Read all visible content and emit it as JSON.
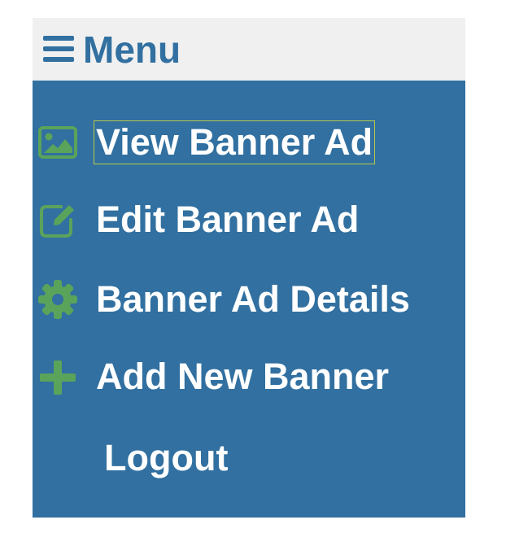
{
  "menu": {
    "title": "Menu",
    "icon": "hamburger-icon",
    "colors": {
      "header_bg": "#f0f0f0",
      "body_bg": "#3170a0",
      "accent": "#3170a0",
      "icon_green": "#5aa35a",
      "item_text": "#ffffff",
      "focus_outline": "#b8c84a"
    },
    "items": [
      {
        "label": "View Banner Ad",
        "icon": "image-icon",
        "focused": true
      },
      {
        "label": "Edit Banner Ad",
        "icon": "edit-icon",
        "focused": false
      },
      {
        "label": "Banner Ad Details",
        "icon": "gear-icon",
        "focused": false
      },
      {
        "label": "Add New Banner",
        "icon": "plus-icon",
        "focused": false
      },
      {
        "label": "Logout",
        "icon": "",
        "focused": false
      }
    ]
  }
}
